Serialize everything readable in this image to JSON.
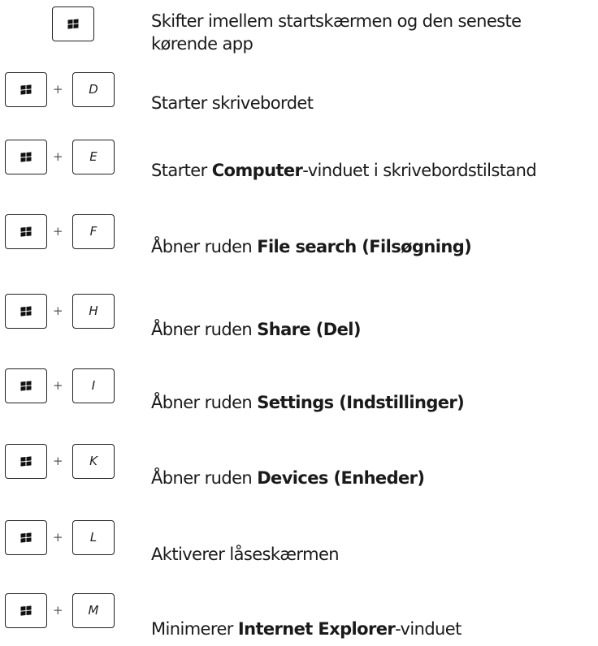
{
  "shortcuts": [
    {
      "key": "",
      "text": "Skifter imellem startskærmen og den seneste kørende app"
    },
    {
      "key": "D",
      "pre": "Starter skrivebordet",
      "bold": "",
      "post": ""
    },
    {
      "key": "E",
      "pre": "Starter ",
      "bold": "Computer",
      "post": "-vinduet i skrivebordstilstand"
    },
    {
      "key": "F",
      "pre": "Åbner ruden ",
      "bold": "File search (Filsøgning)",
      "post": ""
    },
    {
      "key": "H",
      "pre": "Åbner ruden ",
      "bold": "Share (Del)",
      "post": ""
    },
    {
      "key": "I",
      "pre": "Åbner ruden ",
      "bold": "Settings (Indstillinger)",
      "post": ""
    },
    {
      "key": "K",
      "pre": "Åbner ruden ",
      "bold": "Devices (Enheder)",
      "post": ""
    },
    {
      "key": "L",
      "pre": "Aktiverer låseskærmen",
      "bold": "",
      "post": ""
    },
    {
      "key": "M",
      "pre": "Minimerer ",
      "bold": "Internet Explorer",
      "post": "-vinduet"
    }
  ],
  "plus_sign": "+",
  "icons": {
    "windows_key": "windows-logo-icon"
  }
}
